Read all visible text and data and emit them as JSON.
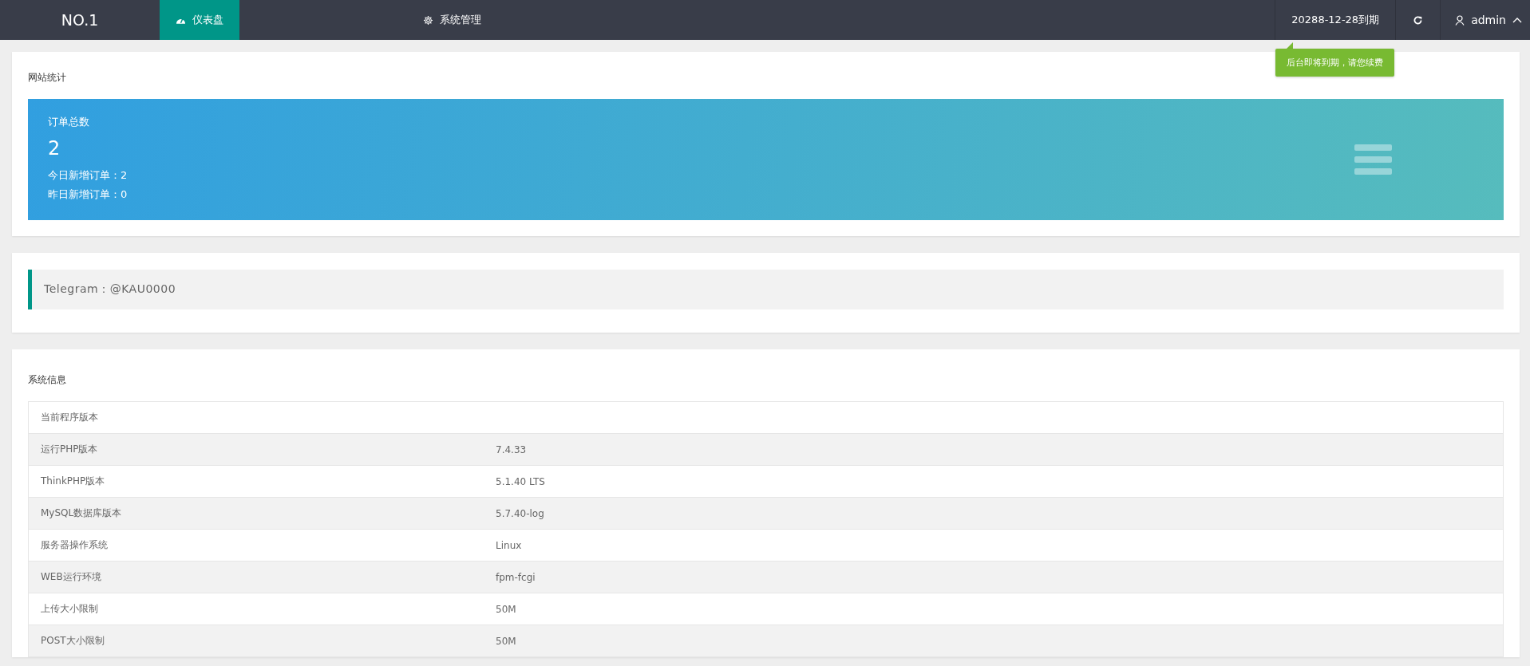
{
  "header": {
    "logo": "NO.1",
    "tabs": [
      {
        "label": "仪表盘",
        "selected": true
      },
      {
        "label": "系统管理",
        "selected": false
      }
    ],
    "expiry": "20288-12-28到期",
    "user": "admin",
    "tooltip": "后台即将到期，请您续费"
  },
  "stats": {
    "title": "网站统计",
    "banner": {
      "label": "订单总数",
      "total": "2",
      "lines": [
        "今日新增订单：2",
        "昨日新增订单：0"
      ]
    }
  },
  "notice": "Telegram：@KAU0000",
  "system_info": {
    "title": "系统信息",
    "rows": [
      {
        "label": "当前程序版本"
      },
      {
        "label": "运行PHP版本",
        "value": "7.4.33"
      },
      {
        "label": "ThinkPHP版本",
        "value": "5.1.40 LTS"
      },
      {
        "label": "MySQL数据库版本",
        "value": "5.7.40-log"
      },
      {
        "label": "服务器操作系统",
        "value": "Linux"
      },
      {
        "label": "WEB运行环境",
        "value": "fpm-fcgi"
      },
      {
        "label": "上传大小限制",
        "value": "50M"
      },
      {
        "label": "POST大小限制",
        "value": "50M"
      }
    ]
  }
}
